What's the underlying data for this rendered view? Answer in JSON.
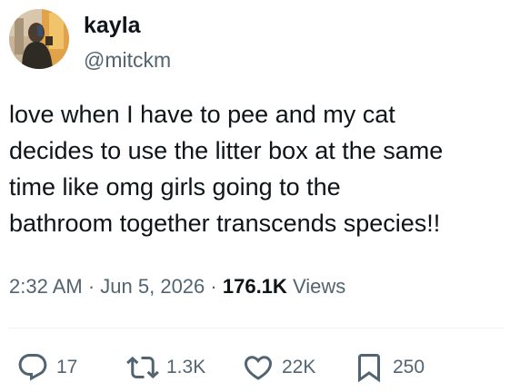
{
  "user": {
    "display_name": "kayla",
    "handle": "@mitckm"
  },
  "tweet": {
    "lines": [
      "love when I have to pee and my cat",
      "decides to use the litter box at the same",
      "time like omg girls going to the",
      "bathroom together transcends species!!"
    ],
    "time": "2:32 AM",
    "separator": "·",
    "date": "Jun 5, 2026",
    "views_count": "176.1K",
    "views_label": "Views"
  },
  "actions": {
    "replies": {
      "icon": "reply-icon",
      "count": "17"
    },
    "retweets": {
      "icon": "retweet-icon",
      "count": "1.3K"
    },
    "likes": {
      "icon": "heart-icon",
      "count": "22K"
    },
    "bookmarks": {
      "icon": "bookmark-icon",
      "count": "250"
    }
  },
  "colors": {
    "text": "#0f1419",
    "secondary": "#536471",
    "divider": "#eff3f4"
  }
}
